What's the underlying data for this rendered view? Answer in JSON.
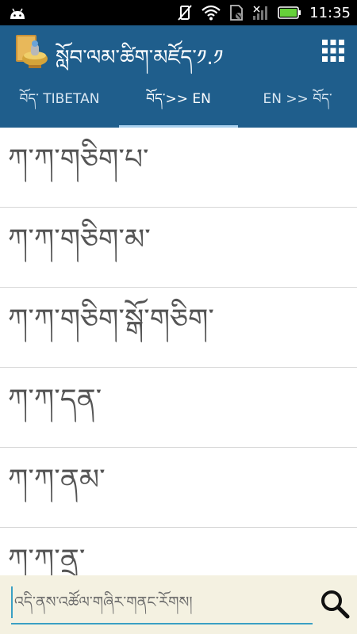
{
  "status_bar": {
    "time": "11:35"
  },
  "app_bar": {
    "title": "སློབ་ལམ་ཚིག་མཛོད་༡.༡"
  },
  "tabs": [
    {
      "label": "བོད་ TIBETAN",
      "active": false
    },
    {
      "label": "བོད་>> EN",
      "active": true
    },
    {
      "label": "EN >> བོད་",
      "active": false
    }
  ],
  "list": {
    "items": [
      "ཀ་ཀ་གཅིག་པ་",
      "ཀ་ཀ་གཅིག་མ་",
      "ཀ་ཀ་གཅིག་སྒོ་གཅིག་",
      "ཀ་ཀ་དན་",
      "ཀ་ཀ་ནམ་",
      "ཀ་ཀ་ནྲ་"
    ]
  },
  "search": {
    "placeholder": "འདི་ནས་འཚོལ་གཞིར་གནང་རོགས།"
  },
  "colors": {
    "app_bar": "#1f5e8c",
    "tab_indicator": "#a9d0ee",
    "search_bg": "#f4f1e1",
    "search_accent": "#3aa0c4"
  }
}
